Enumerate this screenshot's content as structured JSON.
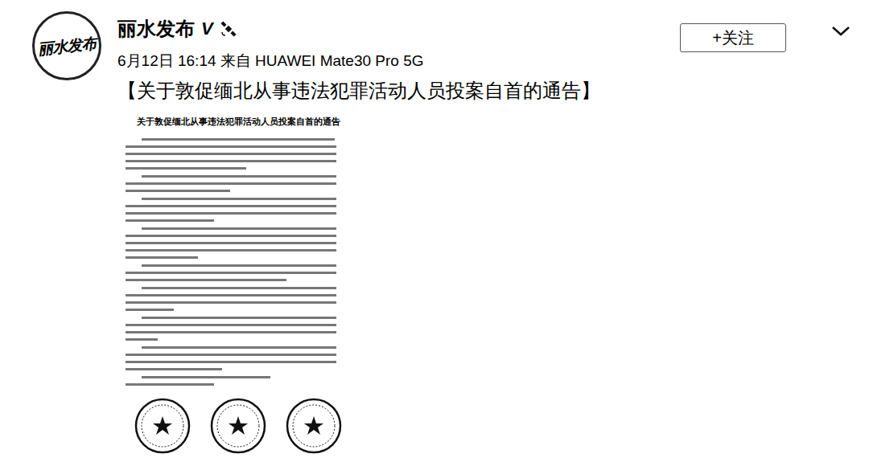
{
  "account": {
    "avatar_text": "丽水发布",
    "name": "丽水发布",
    "verified_badge": "V",
    "posted": "6月12日 16:14 来自 HUAWEI Mate30 Pro 5G"
  },
  "follow_button": "+关注",
  "post": {
    "title": "【关于敦促缅北从事违法犯罪活动人员投案自首的通告】",
    "document": {
      "title": "关于敦促缅北从事违法犯罪活动人员投案自首的通告"
    }
  }
}
